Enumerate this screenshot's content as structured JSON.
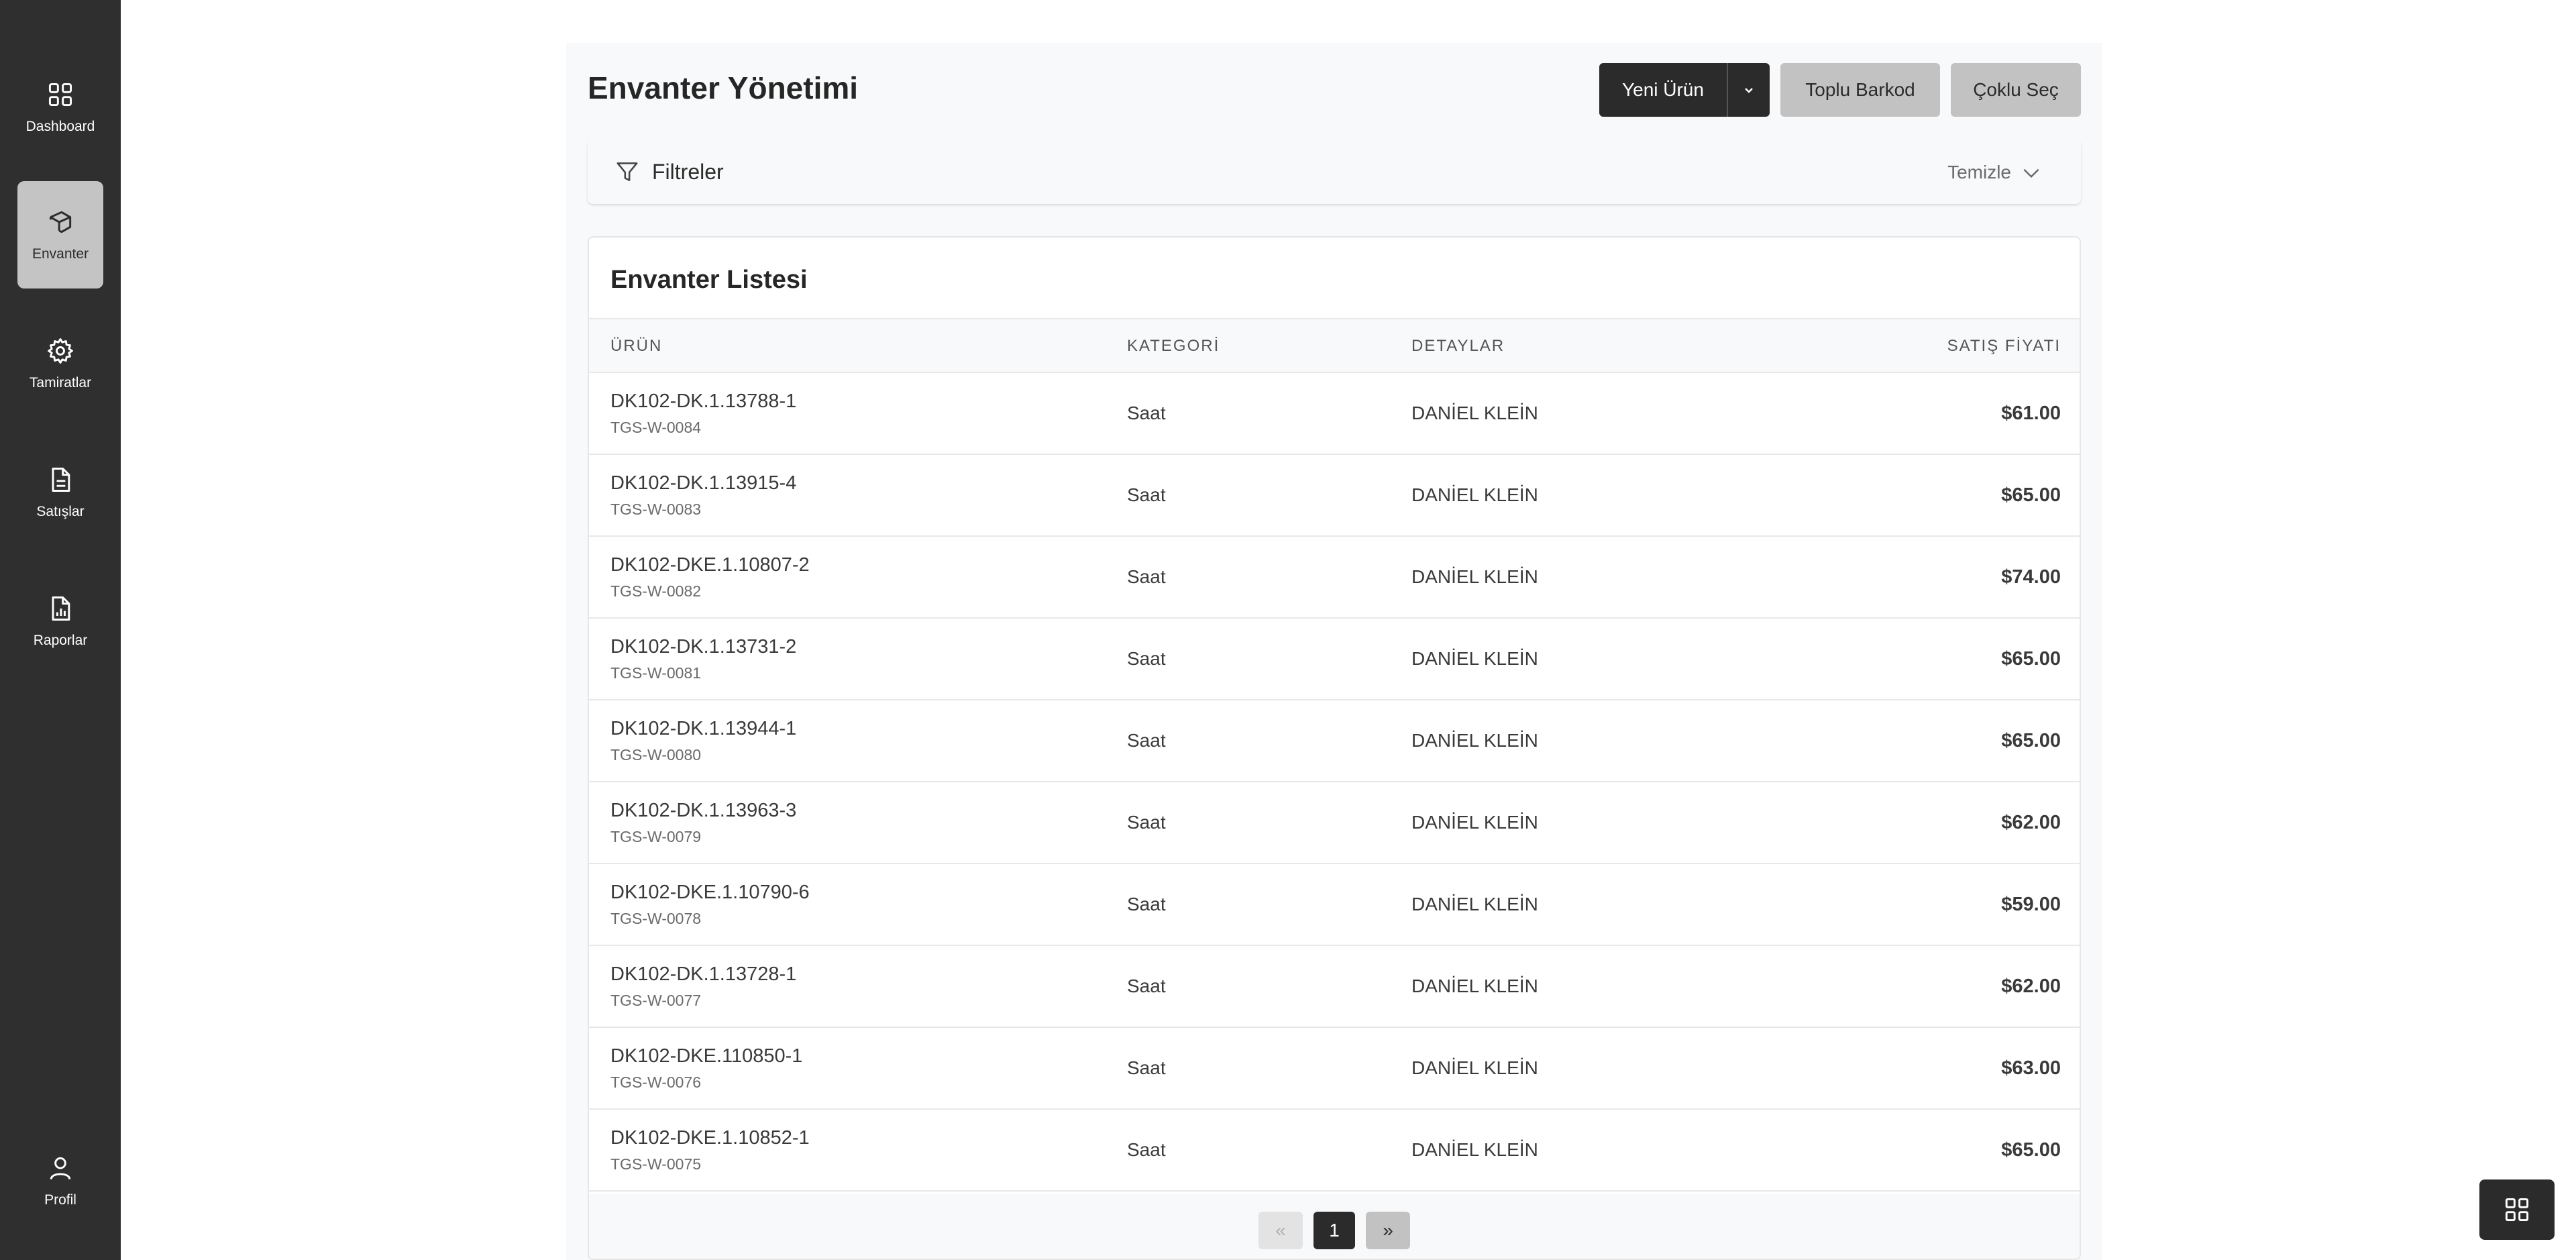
{
  "sidebar": {
    "items": [
      {
        "label": "Dashboard",
        "icon": "grid-icon",
        "active": false
      },
      {
        "label": "Envanter",
        "icon": "box-icon",
        "active": true
      },
      {
        "label": "Tamiratlar",
        "icon": "gear-icon",
        "active": false
      },
      {
        "label": "Satışlar",
        "icon": "document-icon",
        "active": false
      },
      {
        "label": "Raporlar",
        "icon": "report-icon",
        "active": false
      }
    ],
    "profile": {
      "label": "Profil",
      "icon": "user-icon"
    }
  },
  "header": {
    "title": "Envanter Yönetimi",
    "new_product_label": "Yeni Ürün",
    "bulk_barcode_label": "Toplu Barkod",
    "multi_select_label": "Çoklu Seç"
  },
  "filters": {
    "label": "Filtreler",
    "clear_label": "Temizle"
  },
  "inventory": {
    "title": "Envanter Listesi",
    "columns": [
      "ÜRÜN",
      "KATEGORİ",
      "DETAYLAR",
      "SATIŞ FİYATI"
    ],
    "rows": [
      {
        "code": "DK102-DK.1.13788-1",
        "sku": "TGS-W-0084",
        "category": "Saat",
        "details": "DANİEL KLEİN",
        "price": "$61.00"
      },
      {
        "code": "DK102-DK.1.13915-4",
        "sku": "TGS-W-0083",
        "category": "Saat",
        "details": "DANİEL KLEİN",
        "price": "$65.00"
      },
      {
        "code": "DK102-DKE.1.10807-2",
        "sku": "TGS-W-0082",
        "category": "Saat",
        "details": "DANİEL KLEİN",
        "price": "$74.00"
      },
      {
        "code": "DK102-DK.1.13731-2",
        "sku": "TGS-W-0081",
        "category": "Saat",
        "details": "DANİEL KLEİN",
        "price": "$65.00"
      },
      {
        "code": "DK102-DK.1.13944-1",
        "sku": "TGS-W-0080",
        "category": "Saat",
        "details": "DANİEL KLEİN",
        "price": "$65.00"
      },
      {
        "code": "DK102-DK.1.13963-3",
        "sku": "TGS-W-0079",
        "category": "Saat",
        "details": "DANİEL KLEİN",
        "price": "$62.00"
      },
      {
        "code": "DK102-DKE.1.10790-6",
        "sku": "TGS-W-0078",
        "category": "Saat",
        "details": "DANİEL KLEİN",
        "price": "$59.00"
      },
      {
        "code": "DK102-DK.1.13728-1",
        "sku": "TGS-W-0077",
        "category": "Saat",
        "details": "DANİEL KLEİN",
        "price": "$62.00"
      },
      {
        "code": "DK102-DKE.110850-1",
        "sku": "TGS-W-0076",
        "category": "Saat",
        "details": "DANİEL KLEİN",
        "price": "$63.00"
      },
      {
        "code": "DK102-DKE.1.10852-1",
        "sku": "TGS-W-0075",
        "category": "Saat",
        "details": "DANİEL KLEİN",
        "price": "$65.00"
      }
    ]
  },
  "pagination": {
    "prev_label": "«",
    "current_page": "1",
    "next_label": "»"
  },
  "colors": {
    "sidebar_bg": "#2f2f2f",
    "active_nav_bg": "#c4c4c4",
    "primary_button": "#2b2b2b",
    "secondary_button": "#c2c2c2"
  }
}
